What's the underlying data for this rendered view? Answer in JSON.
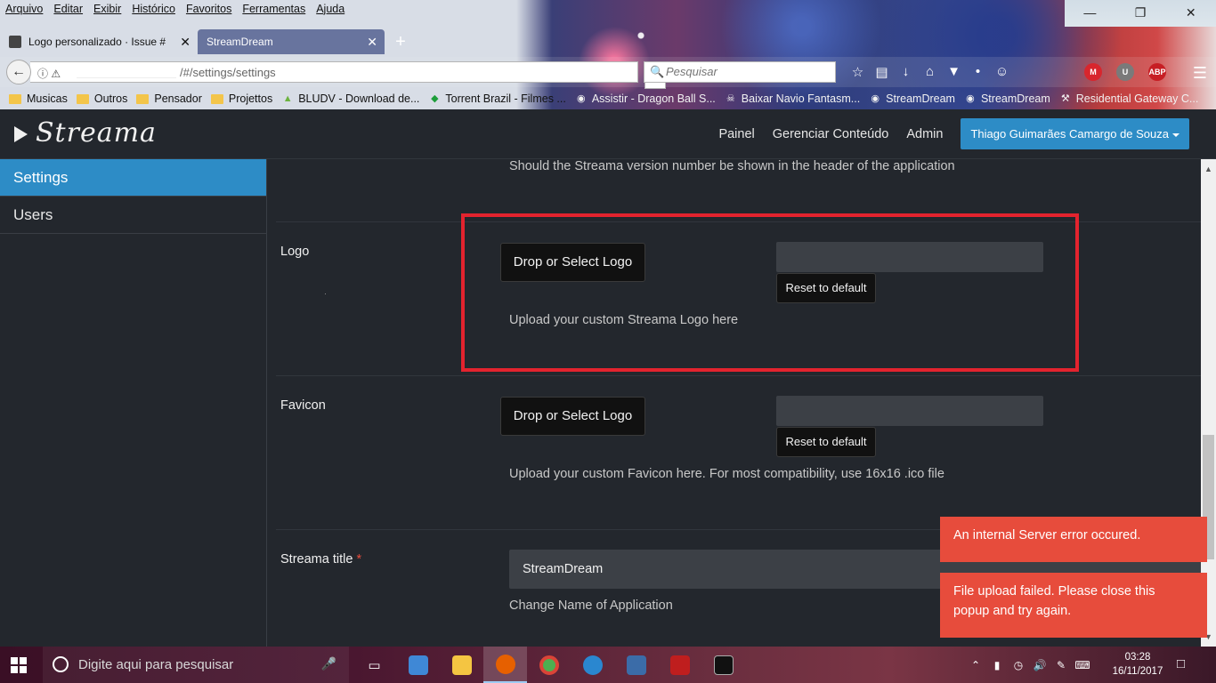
{
  "browser": {
    "menu": [
      "Arquivo",
      "Editar",
      "Exibir",
      "Histórico",
      "Favoritos",
      "Ferramentas",
      "Ajuda"
    ],
    "tabs": [
      {
        "title": "Logo personalizado · Issue #",
        "active": false
      },
      {
        "title": "StreamDream",
        "active": true
      }
    ],
    "url": "/#/settings/settings",
    "search_placeholder": "Pesquisar",
    "bookmarks": [
      "Musicas",
      "Outros",
      "Pensador",
      "Projettos",
      "BLUDV - Download de...",
      "Torrent Brazil - Filmes ...",
      "Assistir - Dragon Ball S...",
      "Baixar Navio Fantasm...",
      "StreamDream",
      "StreamDream",
      "Residential Gateway C..."
    ],
    "extensions": [
      "M",
      "U",
      "ABP"
    ]
  },
  "app": {
    "logo": "Streama",
    "nav": [
      "Painel",
      "Gerenciar Conteúdo",
      "Admin"
    ],
    "user": "Thiago Guimarães Camargo de Souza"
  },
  "sidebar": {
    "items": [
      {
        "label": "Settings",
        "active": true
      },
      {
        "label": "Users",
        "active": false
      }
    ]
  },
  "settings": {
    "version_help": "Should the Streama version number be shown in the header of the application",
    "logo": {
      "label": "Logo",
      "button": "Drop or Select Logo",
      "reset": "Reset to default",
      "help": "Upload your custom Streama Logo here"
    },
    "favicon": {
      "label": "Favicon",
      "button": "Drop or Select Logo",
      "reset": "Reset to default",
      "help": "Upload your custom Favicon here. For most compatibility, use 16x16 .ico file"
    },
    "title": {
      "label": "Streama title",
      "required": "*",
      "value": "StreamDream",
      "help": "Change Name of Application"
    }
  },
  "toasts": [
    "An internal Server error occured.",
    "File upload failed. Please close this popup and try again."
  ],
  "taskbar": {
    "search_placeholder": "Digite aqui para pesquisar",
    "time": "03:28",
    "date": "16/11/2017"
  },
  "colors": {
    "accent": "#2d8cc6",
    "error": "#e74c3c",
    "highlight": "#e3232e",
    "background": "#23272d"
  }
}
